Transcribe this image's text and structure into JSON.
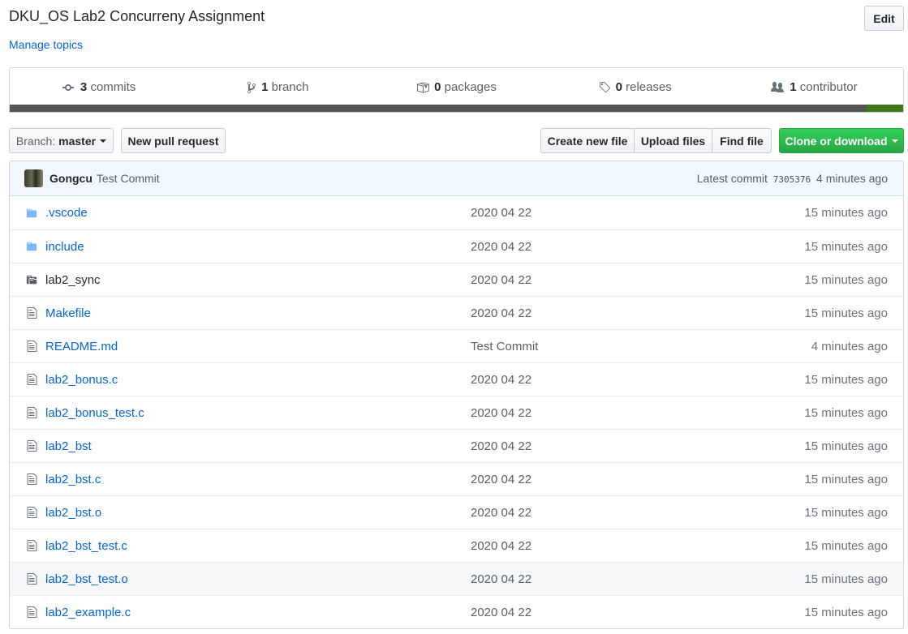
{
  "repo": {
    "title": "DKU_OS Lab2 Concurreny Assignment",
    "manage_topics": "Manage topics",
    "edit_label": "Edit"
  },
  "summary": {
    "commits": {
      "count": "3",
      "label": "commits"
    },
    "branches": {
      "count": "1",
      "label": "branch"
    },
    "packages": {
      "count": "0",
      "label": "packages"
    },
    "releases": {
      "count": "0",
      "label": "releases"
    },
    "contributors": {
      "count": "1",
      "label": "contributor"
    }
  },
  "languages": [
    {
      "color": "#555555",
      "percent": 95.9
    },
    {
      "color": "#427819",
      "percent": 4.1
    }
  ],
  "toolbar": {
    "branch_label": "Branch:",
    "branch_value": "master",
    "new_pr": "New pull request",
    "create_file": "Create new file",
    "upload_files": "Upload files",
    "find_file": "Find file",
    "clone": "Clone or download"
  },
  "commit": {
    "author": "Gongcu",
    "message": "Test Commit",
    "latest_label": "Latest commit",
    "sha": "7305376",
    "age": "4 minutes ago"
  },
  "files": [
    {
      "type": "dir",
      "name": ".vscode",
      "message": "2020 04 22",
      "age": "15 minutes ago"
    },
    {
      "type": "dir",
      "name": "include",
      "message": "2020 04 22",
      "age": "15 minutes ago"
    },
    {
      "type": "submodule",
      "name": "lab2_sync",
      "message": "2020 04 22",
      "age": "15 minutes ago"
    },
    {
      "type": "file",
      "name": "Makefile",
      "message": "2020 04 22",
      "age": "15 minutes ago"
    },
    {
      "type": "file",
      "name": "README.md",
      "message": "Test Commit",
      "age": "4 minutes ago"
    },
    {
      "type": "file",
      "name": "lab2_bonus.c",
      "message": "2020 04 22",
      "age": "15 minutes ago"
    },
    {
      "type": "file",
      "name": "lab2_bonus_test.c",
      "message": "2020 04 22",
      "age": "15 minutes ago"
    },
    {
      "type": "file",
      "name": "lab2_bst",
      "message": "2020 04 22",
      "age": "15 minutes ago"
    },
    {
      "type": "file",
      "name": "lab2_bst.c",
      "message": "2020 04 22",
      "age": "15 minutes ago"
    },
    {
      "type": "file",
      "name": "lab2_bst.o",
      "message": "2020 04 22",
      "age": "15 minutes ago"
    },
    {
      "type": "file",
      "name": "lab2_bst_test.c",
      "message": "2020 04 22",
      "age": "15 minutes ago"
    },
    {
      "type": "file",
      "name": "lab2_bst_test.o",
      "message": "2020 04 22",
      "age": "15 minutes ago",
      "highlighted": true
    },
    {
      "type": "file",
      "name": "lab2_example.c",
      "message": "2020 04 22",
      "age": "15 minutes ago"
    }
  ]
}
